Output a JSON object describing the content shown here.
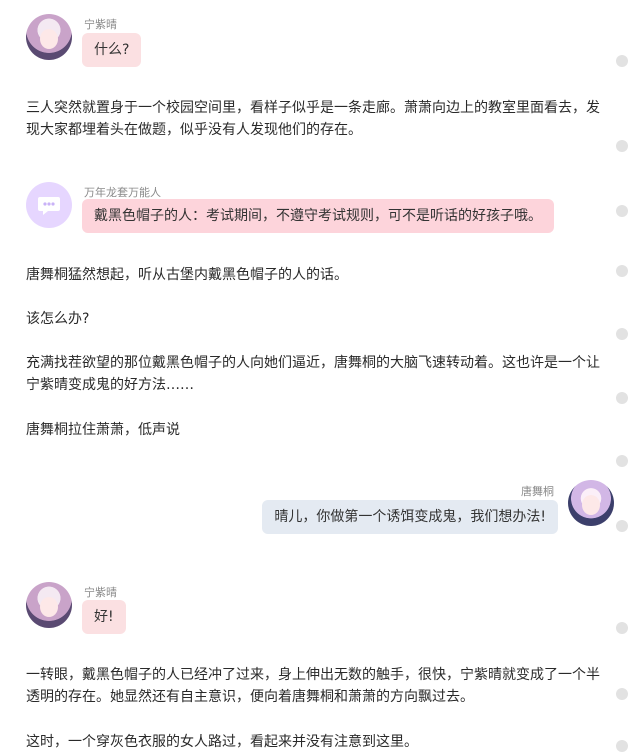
{
  "messages": {
    "m1": {
      "name": "宁紫晴",
      "text": "什么?"
    },
    "p1": "三人突然就置身于一个校园空间里，看样子似乎是一条走廊。萧萧向边上的教室里面看去，发现大家都埋着头在做题，似乎没有人发现他们的存在。",
    "m2": {
      "name": "万年龙套万能人",
      "text": "戴黑色帽子的人：考试期间，不遵守考试规则，可不是听话的好孩子哦。"
    },
    "p2": "唐舞桐猛然想起，听从古堡内戴黑色帽子的人的话。",
    "p3": "该怎么办?",
    "p4": "充满找茬欲望的那位戴黑色帽子的人向她们逼近，唐舞桐的大脑飞速转动着。这也许是一个让宁紫晴变成鬼的好方法……",
    "p5": "唐舞桐拉住萧萧，低声说",
    "m3": {
      "name": "唐舞桐",
      "text": "晴儿，你做第一个诱饵变成鬼，我们想办法!"
    },
    "m4": {
      "name": "宁紫晴",
      "text": "好!"
    },
    "p6": "一转眼，戴黑色帽子的人已经冲了过来，身上伸出无数的触手，很快，宁紫晴就变成了一个半透明的存在。她显然还有自主意识，便向着唐舞桐和萧萧的方向飘过去。",
    "p7": "这时，一个穿灰色衣服的女人路过，看起来并没有注意到这里。"
  },
  "icons": {
    "avatar_ning": "avatar-girl-icon",
    "avatar_bot": "chat-bubble-icon",
    "avatar_tang": "avatar-girl-icon",
    "scroll_dot": "scroll-dot-icon"
  },
  "colors": {
    "bubble_pink": "#fbe0e2",
    "bubble_pink_strong": "#fdd4db",
    "bubble_blue": "#e4eaf2",
    "bot_avatar_bg": "#e6d6ff",
    "bot_icon": "#ffffff"
  }
}
